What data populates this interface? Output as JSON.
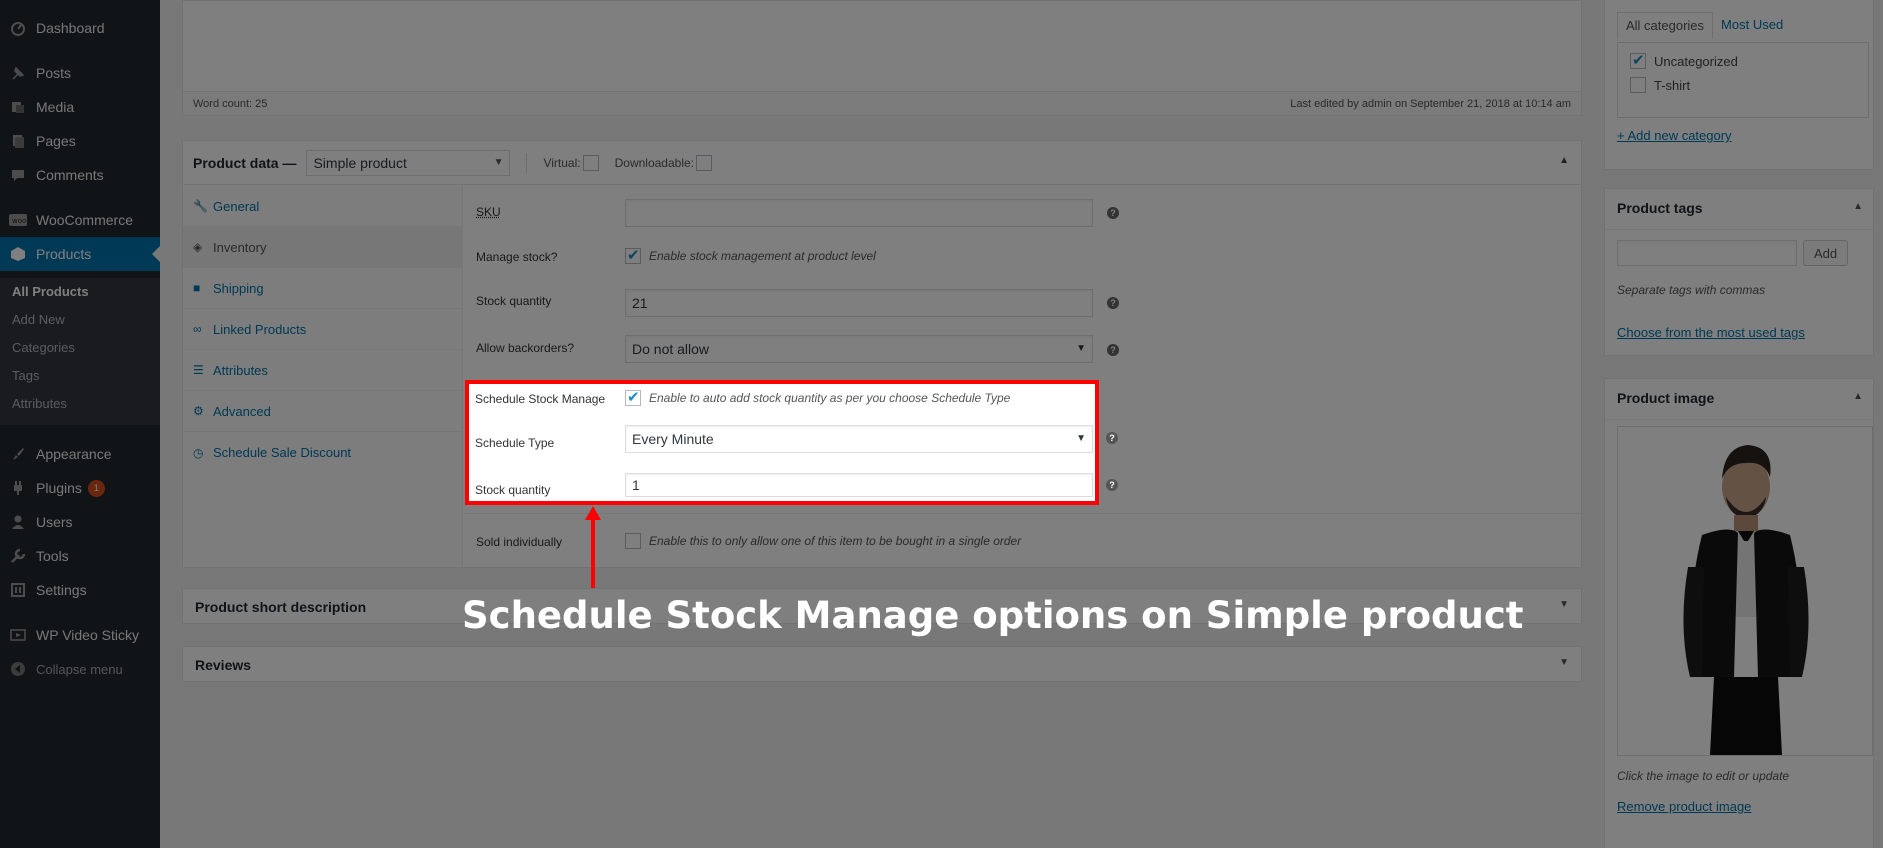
{
  "sidebar": {
    "items": [
      {
        "label": "Dashboard",
        "icon": "dashboard-icon"
      },
      {
        "label": "Posts",
        "icon": "pin-icon"
      },
      {
        "label": "Media",
        "icon": "media-icon"
      },
      {
        "label": "Pages",
        "icon": "page-icon"
      },
      {
        "label": "Comments",
        "icon": "comment-icon"
      },
      {
        "label": "WooCommerce",
        "icon": "woo-icon"
      },
      {
        "label": "Products",
        "icon": "cube-icon"
      },
      {
        "label": "Appearance",
        "icon": "brush-icon"
      },
      {
        "label": "Plugins",
        "icon": "plug-icon",
        "badge": "1"
      },
      {
        "label": "Users",
        "icon": "user-icon"
      },
      {
        "label": "Tools",
        "icon": "wrench-icon"
      },
      {
        "label": "Settings",
        "icon": "settings-icon"
      },
      {
        "label": "WP Video Sticky",
        "icon": "video-icon"
      },
      {
        "label": "Collapse menu",
        "icon": "collapse-icon"
      }
    ],
    "submenu": [
      "All Products",
      "Add New",
      "Categories",
      "Tags",
      "Attributes"
    ]
  },
  "editor": {
    "word_count": "Word count: 25",
    "last_edited": "Last edited by admin on September 21, 2018 at 10:14 am"
  },
  "product_data": {
    "title": "Product data —",
    "type_value": "Simple product",
    "virtual_label": "Virtual:",
    "downloadable_label": "Downloadable:",
    "tabs": [
      {
        "label": "General",
        "icon": "wrench-icon"
      },
      {
        "label": "Inventory",
        "icon": "tag-icon"
      },
      {
        "label": "Shipping",
        "icon": "truck-icon"
      },
      {
        "label": "Linked Products",
        "icon": "link-icon"
      },
      {
        "label": "Attributes",
        "icon": "list-icon"
      },
      {
        "label": "Advanced",
        "icon": "gear-icon"
      },
      {
        "label": "Schedule Sale Discount",
        "icon": "clock-icon"
      }
    ],
    "fields": {
      "sku_label": "SKU",
      "sku_value": "",
      "manage_stock_label": "Manage stock?",
      "manage_stock_text": "Enable stock management at product level",
      "stock_qty_label": "Stock quantity",
      "stock_qty_value": "21",
      "backorders_label": "Allow backorders?",
      "backorders_value": "Do not allow",
      "schedule_manage_label": "Schedule Stock Manage",
      "schedule_manage_text": "Enable to auto add stock quantity as per you choose Schedule Type",
      "schedule_type_label": "Schedule Type",
      "schedule_type_value": "Every Minute",
      "schedule_qty_label": "Stock quantity",
      "schedule_qty_value": "1",
      "sold_individually_label": "Sold individually",
      "sold_individually_text": "Enable this to only allow one of this item to be bought in a single order"
    }
  },
  "short_description": {
    "title": "Product short description"
  },
  "reviews": {
    "title": "Reviews"
  },
  "categories": {
    "tabs": [
      "All categories",
      "Most Used"
    ],
    "items": [
      {
        "label": "Uncategorized",
        "checked": true
      },
      {
        "label": "T-shirt",
        "checked": false
      }
    ],
    "add_link": "+ Add new category"
  },
  "tags": {
    "title": "Product tags",
    "add_button": "Add",
    "hint": "Separate tags with commas",
    "choose_link": "Choose from the most used tags"
  },
  "image": {
    "title": "Product image",
    "hint": "Click the image to edit or update",
    "remove_link": "Remove product image"
  },
  "annotation": {
    "caption": "Schedule Stock Manage options on Simple product",
    "color": "#ff0000"
  }
}
